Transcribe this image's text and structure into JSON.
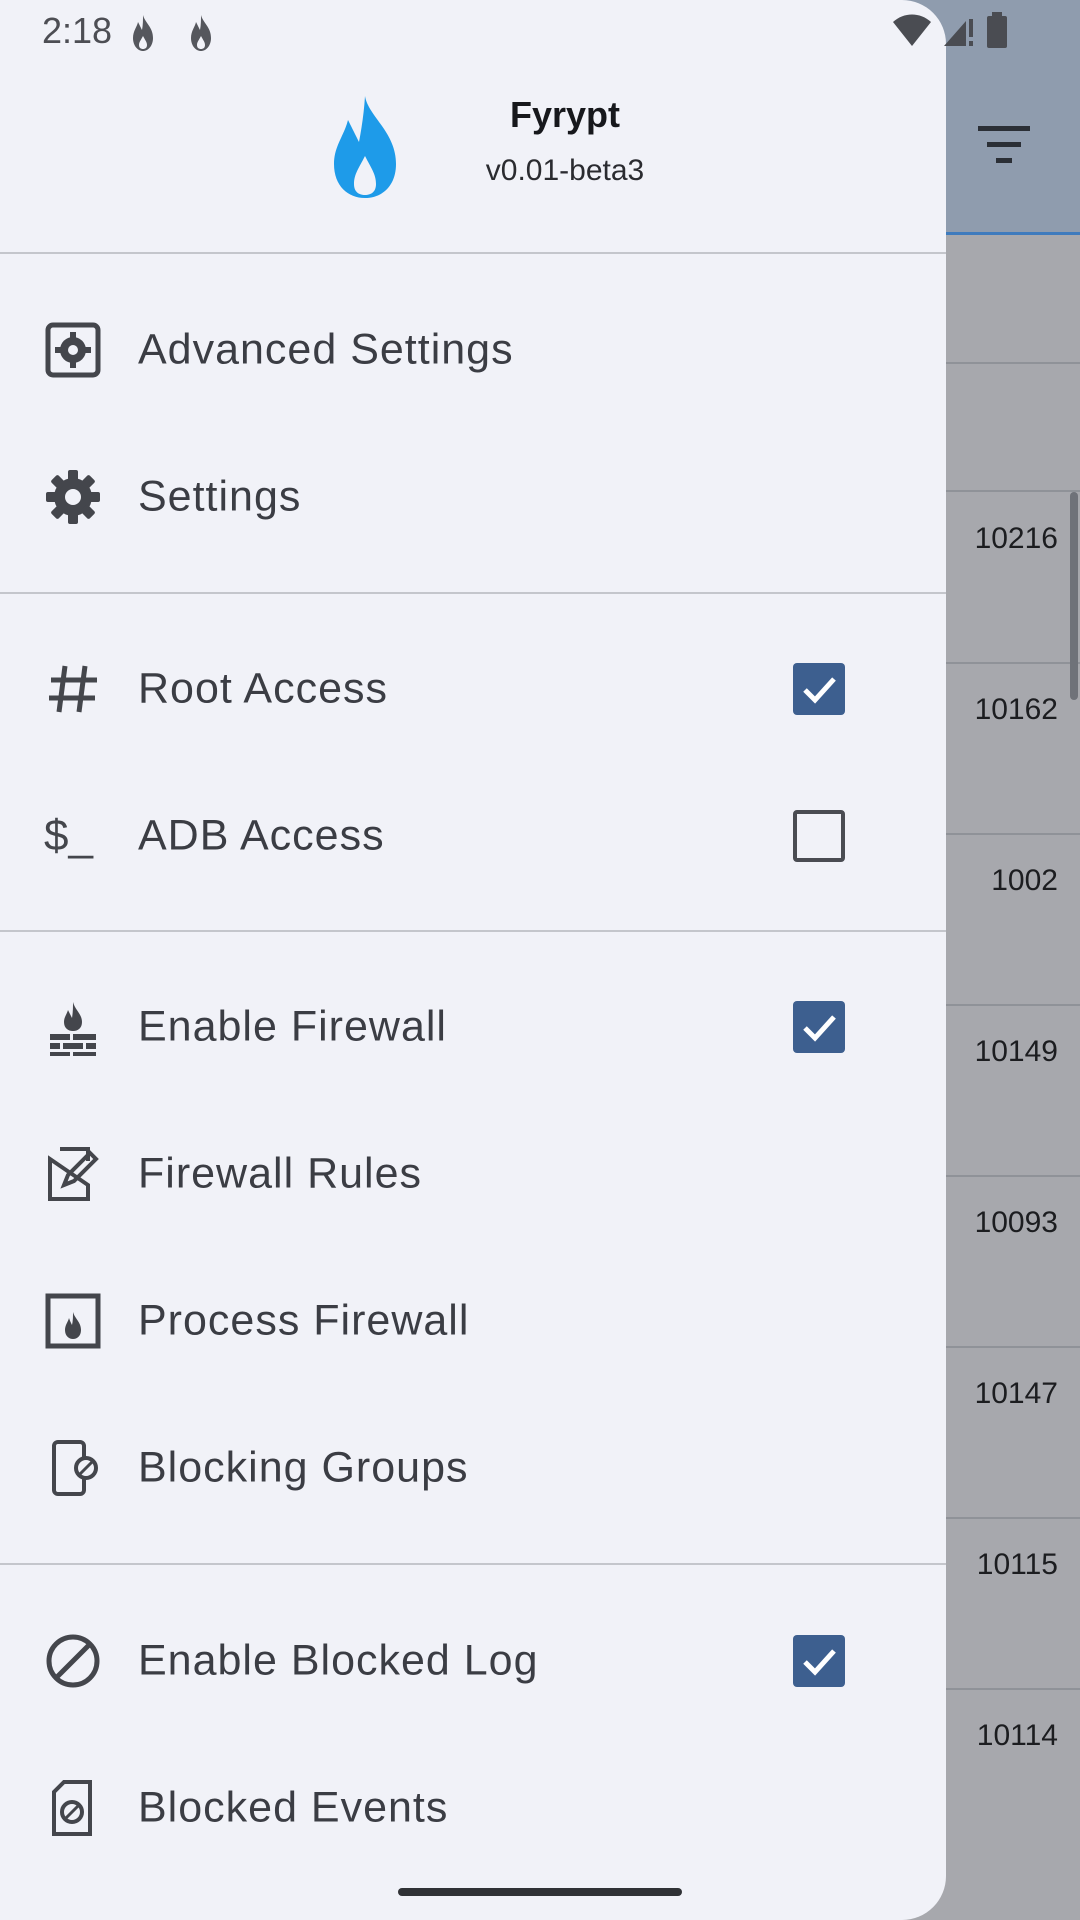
{
  "status_bar": {
    "time": "2:18"
  },
  "drawer": {
    "app_name": "Fyrypt",
    "app_version": "v0.01-beta3",
    "items": [
      {
        "label": "Advanced Settings",
        "icon": "advanced-settings-icon"
      },
      {
        "label": "Settings",
        "icon": "gear-icon"
      },
      {
        "label": "Root Access",
        "icon": "hash-icon",
        "checked": true
      },
      {
        "label": "ADB Access",
        "icon": "terminal-icon",
        "icon_text": "$_",
        "checked": false
      },
      {
        "label": "Enable Firewall",
        "icon": "firewall-icon",
        "checked": true
      },
      {
        "label": "Firewall Rules",
        "icon": "edit-document-icon"
      },
      {
        "label": "Process Firewall",
        "icon": "fireplace-icon"
      },
      {
        "label": "Blocking Groups",
        "icon": "phone-block-icon"
      },
      {
        "label": "Enable Blocked Log",
        "icon": "block-icon",
        "checked": true
      },
      {
        "label": "Blocked Events",
        "icon": "blocked-file-icon"
      }
    ]
  },
  "background_list": {
    "uids": [
      "10216",
      "10162",
      "1002",
      "10149",
      "10093",
      "10147",
      "10115",
      "10114"
    ]
  },
  "colors": {
    "accent_blue": "#1e9be9",
    "checkbox_checked": "#3d5f8f",
    "drawer_bg": "#f1f2f8"
  }
}
